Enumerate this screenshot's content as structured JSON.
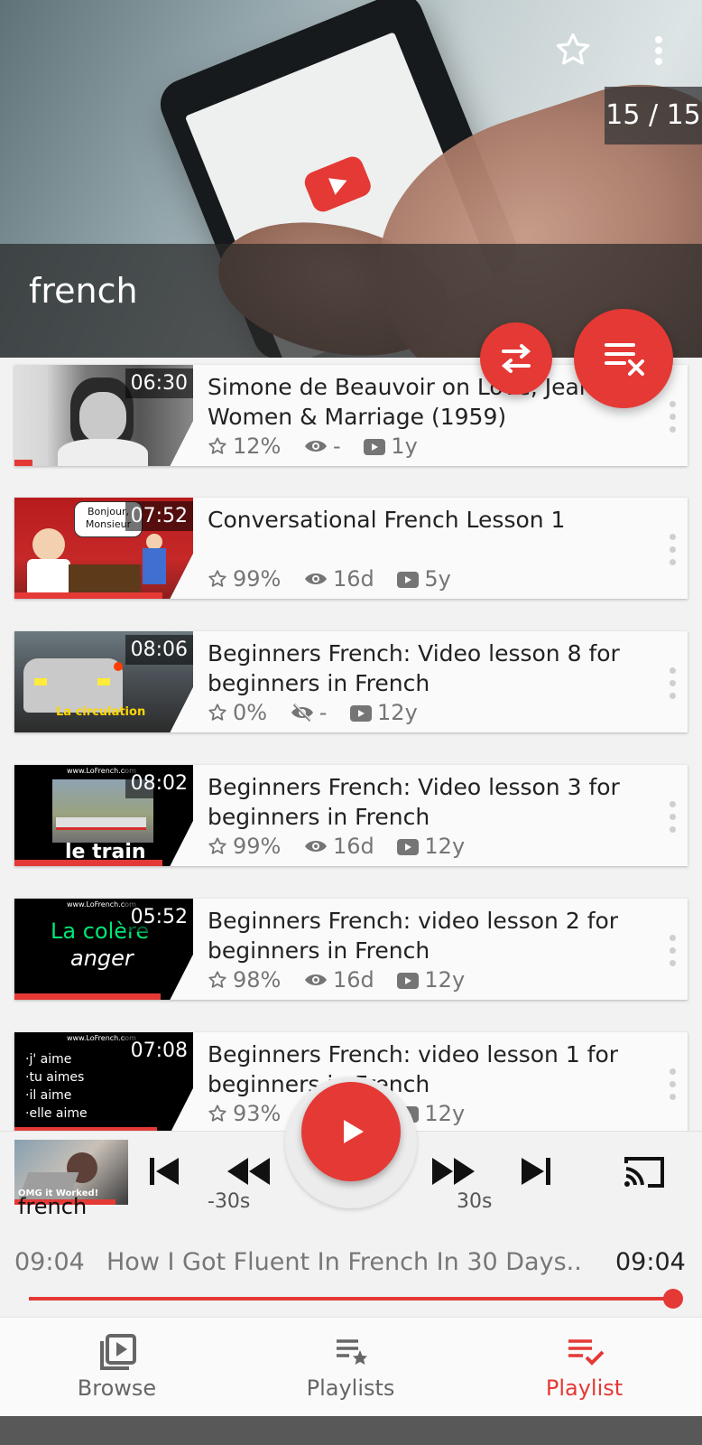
{
  "header": {
    "playlist_title": "french",
    "counter": "15 / 15"
  },
  "videos": [
    {
      "title": "Simone de Beauvoir on Love, Jealousy, Women & Marriage (1959)",
      "duration": "06:30",
      "rating": "12%",
      "views": "-",
      "views_icon": "eye-icon",
      "age": "1y",
      "progress": 0.1
    },
    {
      "title": "Conversational French Lesson 1",
      "duration": "07:52",
      "rating": "99%",
      "views": "16d",
      "views_icon": "eye-icon",
      "age": "5y",
      "progress": 0.83
    },
    {
      "title": "Beginners French: Video lesson 8 for beginners in French",
      "duration": "08:06",
      "rating": "0%",
      "views": "-",
      "views_icon": "eye-off-icon",
      "age": "12y",
      "progress": 0
    },
    {
      "title": "Beginners French: Video lesson 3 for beginners in French",
      "duration": "08:02",
      "rating": "99%",
      "views": "16d",
      "views_icon": "eye-icon",
      "age": "12y",
      "progress": 0.83
    },
    {
      "title": "Beginners French: video lesson 2 for beginners in French",
      "duration": "05:52",
      "rating": "98%",
      "views": "16d",
      "views_icon": "eye-icon",
      "age": "12y",
      "progress": 0.82
    },
    {
      "title": "Beginners French: video lesson 1 for beginners in French",
      "duration": "07:08",
      "rating": "93%",
      "views": "16d",
      "views_icon": "eye-icon",
      "age": "12y",
      "progress": 0.8
    }
  ],
  "thumb_texts": {
    "v2_bubble": "Bonjour, Monsieur",
    "v3_caption": "La circulation",
    "v4_site": "www.LoFrench.com",
    "v4_caption": "le train",
    "v5_site": "www.LoFrench.com",
    "v5_word": "La colère",
    "v5_translation": "anger",
    "v6_site": "www.LoFrench.com",
    "v6_lines": [
      "·j' aime",
      "·tu aimes",
      "·il aime",
      "·elle aime"
    ]
  },
  "player": {
    "mini_label": "french",
    "mini_thumb_caption": "OMG it Worked!",
    "rewind_label": "-30s",
    "forward_label": "30s",
    "elapsed": "09:04",
    "now_playing": "How I Got Fluent In French In 30 Days..",
    "total": "09:04",
    "seek_progress": 1.0
  },
  "nav": {
    "browse": "Browse",
    "playlists": "Playlists",
    "playlist": "Playlist",
    "active": "playlist"
  },
  "colors": {
    "accent": "#e53935",
    "text_primary": "#222222",
    "text_secondary": "#757575"
  }
}
